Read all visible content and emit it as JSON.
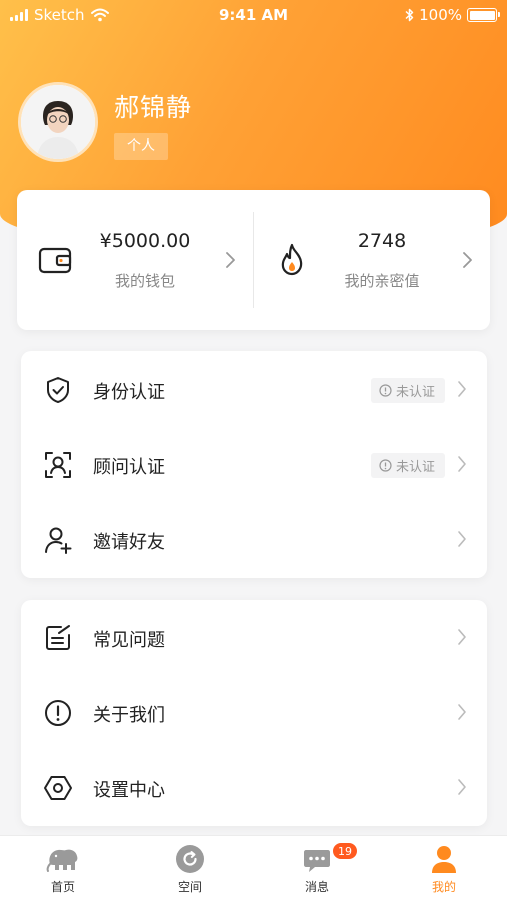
{
  "status_bar": {
    "carrier": "Sketch",
    "time": "9:41 AM",
    "battery": "100%"
  },
  "profile": {
    "name": "郝锦静",
    "tag": "个人",
    "avatar_icon": "user-avatar"
  },
  "wallet": {
    "balance": "¥5000.00",
    "balance_label": "我的钱包",
    "intimacy": "2748",
    "intimacy_label": "我的亲密值"
  },
  "menu_group_1": [
    {
      "label": "身份认证",
      "icon": "shield-icon",
      "badge": "未认证"
    },
    {
      "label": "顾问认证",
      "icon": "face-scan-icon",
      "badge": "未认证"
    },
    {
      "label": "邀请好友",
      "icon": "add-user-icon",
      "badge": ""
    }
  ],
  "menu_group_2": [
    {
      "label": "常见问题",
      "icon": "edit-note-icon"
    },
    {
      "label": "关于我们",
      "icon": "info-circle-icon"
    },
    {
      "label": "设置中心",
      "icon": "hexagon-settings-icon"
    }
  ],
  "tabs": [
    {
      "label": "首页",
      "icon": "elephant-icon"
    },
    {
      "label": "空间",
      "icon": "refresh-circle-icon"
    },
    {
      "label": "消息",
      "icon": "chat-bubble-icon",
      "badge": "19"
    },
    {
      "label": "我的",
      "icon": "person-icon",
      "active": true
    }
  ],
  "colors": {
    "accent": "#ff8a1f",
    "header_start": "#ffc04a",
    "header_end": "#ff8a1f",
    "badge_red": "#ff5a1f"
  }
}
